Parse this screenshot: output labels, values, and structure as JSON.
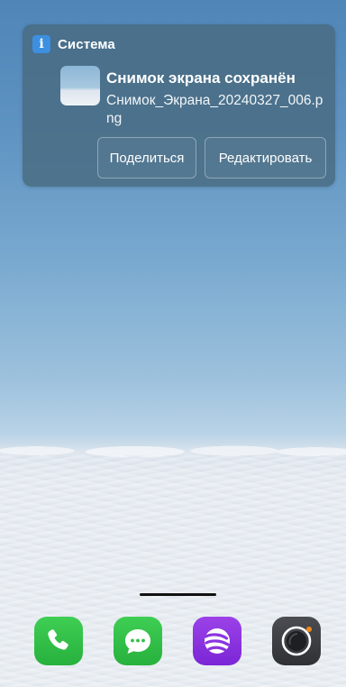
{
  "notification": {
    "app_name": "Система",
    "app_icon": "info-icon",
    "title": "Снимок экрана сохранён",
    "body": "Снимок_Экрана_20240327_006.png",
    "actions": {
      "share_label": "Поделиться",
      "edit_label": "Редактировать"
    }
  },
  "dock": {
    "apps": [
      {
        "name": "phone",
        "icon": "phone-icon",
        "color": "#2fbf45"
      },
      {
        "name": "messages",
        "icon": "message-icon",
        "color": "#2fbf45"
      },
      {
        "name": "browser",
        "icon": "browser-icon",
        "color": "#8a35df"
      },
      {
        "name": "camera",
        "icon": "camera-icon",
        "color": "#3a3c40"
      }
    ]
  },
  "colors": {
    "notification_bg": "#486a80",
    "info_badge": "#3d8fe0",
    "camera_dot": "#f08a1c"
  }
}
